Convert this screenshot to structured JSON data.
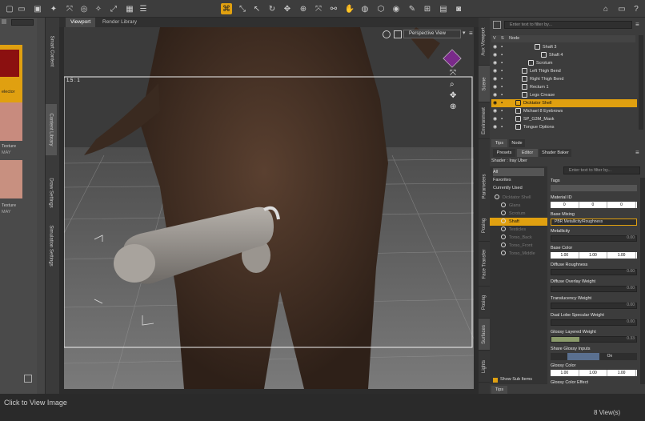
{
  "toolbar": {
    "icons": [
      "node-icon",
      "scene-icon",
      "select-icon",
      "camera-icon",
      "transform-icon",
      "rotate-icon",
      "scale-icon",
      "universal-icon",
      "region-icon",
      "joint-icon",
      "edit-icon",
      "pose-icon",
      "surface-icon",
      "render-icon",
      "ipr-icon",
      "render-settings-icon",
      "home-icon",
      "help-icon"
    ],
    "accent": "#e0a010"
  },
  "left": {
    "vtabs": [
      "Smart Content",
      "Content Library",
      "Draw Settings",
      "Simulation Settings"
    ],
    "selector_label": "elector",
    "thumbs": [
      {
        "label": "Texture",
        "sub": "MAY"
      },
      {
        "label": "Texture",
        "sub": "MAY"
      }
    ]
  },
  "viewport": {
    "tabs": [
      "Viewport",
      "Render Library"
    ],
    "view_mode": "Perspective View",
    "aspect": "1.5 : 1"
  },
  "scene": {
    "search_placeholder": "Enter text to filter by...",
    "header": [
      "V",
      "S",
      "Node"
    ],
    "rows": [
      {
        "label": "Shaft 3",
        "indent": 3
      },
      {
        "label": "Shaft 4",
        "indent": 4
      },
      {
        "label": "Scrotum",
        "indent": 2
      },
      {
        "label": "Left Thigh Bend",
        "indent": 1
      },
      {
        "label": "Right Thigh Bend",
        "indent": 1
      },
      {
        "label": "Rectum 1",
        "indent": 1
      },
      {
        "label": "Legs Crease",
        "indent": 1
      },
      {
        "label": "Dicktator Shell",
        "indent": 0,
        "selected": true
      },
      {
        "label": "Michael 8 Eyebrows",
        "indent": 0
      },
      {
        "label": "SP_G3M_Mask",
        "indent": 0
      },
      {
        "label": "Tongue Options",
        "indent": 0
      }
    ],
    "bottom_tabs": [
      "Tips",
      "Node"
    ],
    "right_vtabs": [
      "Aux Viewport",
      "Scene",
      "Environment"
    ]
  },
  "surfaces": {
    "tabs": [
      "Presets",
      "Editor",
      "Shader Baker"
    ],
    "shader_label": "Shader : Iray Uber",
    "filter_placeholder": "Enter text to filter by...",
    "left_list": [
      "All",
      "Favorites",
      "Currently Used"
    ],
    "tree": [
      {
        "label": "Dicktator Shell",
        "indent": 0,
        "dim": true
      },
      {
        "label": "Glans",
        "indent": 1,
        "dim": true
      },
      {
        "label": "Scrotum",
        "indent": 1,
        "dim": true
      },
      {
        "label": "Shaft",
        "indent": 1,
        "selected": true
      },
      {
        "label": "Testicles",
        "indent": 1,
        "dim": true
      },
      {
        "label": "Torso_Back",
        "indent": 1,
        "dim": true
      },
      {
        "label": "Torso_Front",
        "indent": 1,
        "dim": true
      },
      {
        "label": "Torso_Middle",
        "indent": 1,
        "dim": true
      }
    ],
    "show_sub_items": "Show Sub Items",
    "properties": {
      "tags": "Tags",
      "material_id": {
        "label": "Material ID",
        "v1": "0",
        "v2": "0",
        "v3": "0"
      },
      "base_mixing": {
        "label": "Base Mixing",
        "value": "PBR Metallicity/Roughness"
      },
      "metallicity": {
        "label": "Metallicity",
        "value": "0.00",
        "fraction": 0.0
      },
      "base_color": {
        "label": "Base Color",
        "v1": "1.00",
        "v2": "1.00",
        "v3": "1.00"
      },
      "diffuse_roughness": {
        "label": "Diffuse Roughness",
        "value": "0.00",
        "fraction": 0.0
      },
      "diffuse_overlay_weight": {
        "label": "Diffuse Overlay Weight",
        "value": "0.00",
        "fraction": 0.0
      },
      "translucency_weight": {
        "label": "Translucency Weight",
        "value": "0.00",
        "fraction": 0.0
      },
      "dual_lobe": {
        "label": "Dual Lobe Specular Weight",
        "value": "0.00",
        "fraction": 0.0
      },
      "glossy_layered_weight": {
        "label": "Glossy Layered Weight",
        "value": "0.33",
        "fraction": 0.33
      },
      "share_glossy": {
        "label": "Share Glossy Inputs",
        "value": "On"
      },
      "glossy_color": {
        "label": "Glossy Color",
        "v1": "1.00",
        "v2": "1.00",
        "v3": "1.00"
      },
      "glossy_color_effect": {
        "label": "Glossy Color Effect"
      }
    },
    "right_vtabs": [
      "Parameters",
      "Posing",
      "Face Transfer",
      "Posing",
      "Surfaces",
      "Lights"
    ],
    "bottom_tab": "Tips"
  },
  "status": {
    "left": "Click to View Image",
    "right": "8 View(s)"
  }
}
